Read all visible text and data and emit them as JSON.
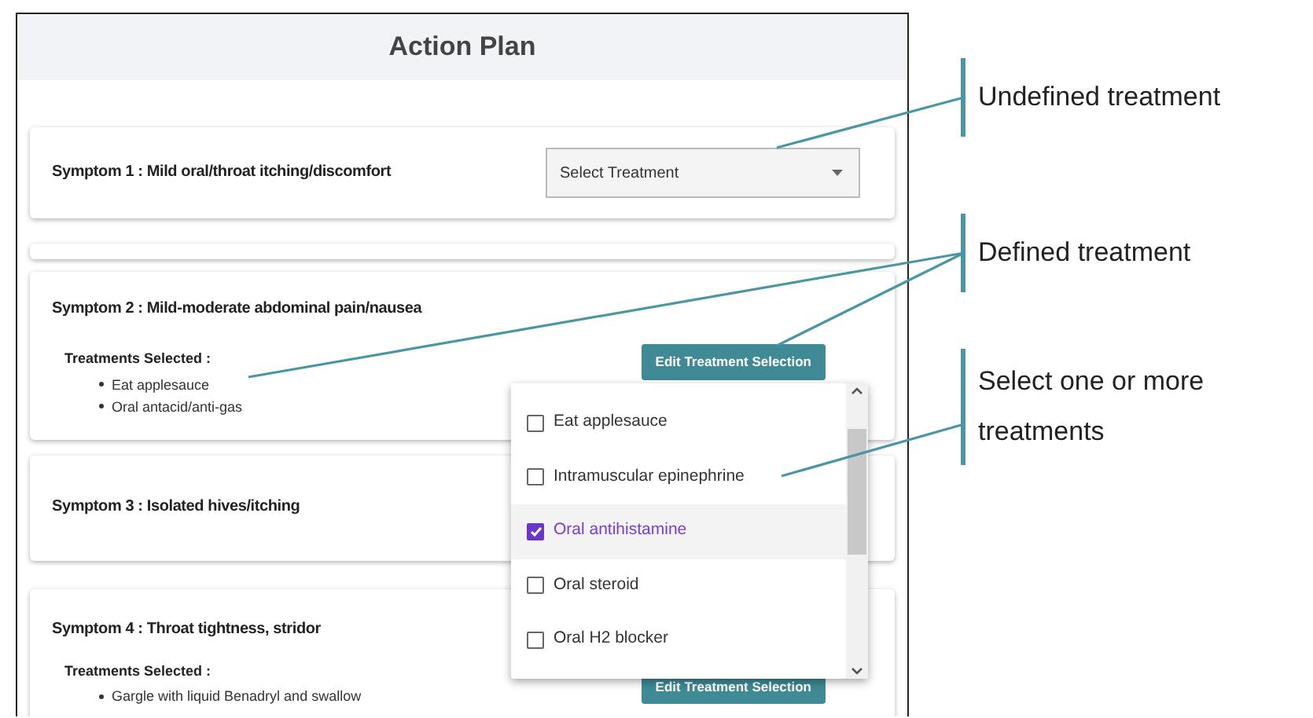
{
  "app": {
    "title": "Action Plan",
    "symptoms": [
      {
        "label": "Symptom 1 : Mild oral/throat itching/discomfort",
        "kind": "select",
        "placeholder": "Select Treatment"
      },
      {
        "label": "Symptom 2 : Mild-moderate abdominal pain/nausea",
        "kind": "selected",
        "treatments_heading": "Treatments Selected :",
        "treatments": [
          "Eat applesauce",
          "Oral antacid/anti-gas"
        ],
        "button": "Edit Treatment Selection"
      },
      {
        "label": "Symptom 3 : Isolated hives/itching",
        "kind": "plain"
      },
      {
        "label": "Symptom 4 : Throat tightness, stridor",
        "kind": "selected",
        "treatments_heading": "Treatments Selected :",
        "treatments": [
          "Gargle with liquid Benadryl and swallow"
        ],
        "button": "Edit Treatment Selection"
      }
    ],
    "menu": {
      "options": [
        {
          "label": "Eat applesauce",
          "checked": false,
          "selected": false
        },
        {
          "label": "Intramuscular epinephrine",
          "checked": false,
          "selected": false
        },
        {
          "label": "Oral antihistamine",
          "checked": true,
          "selected": true
        },
        {
          "label": "Oral steroid",
          "checked": false,
          "selected": false
        },
        {
          "label": "Oral H2 blocker",
          "checked": false,
          "selected": false
        }
      ]
    }
  },
  "annotations": [
    {
      "text": "Undefined treatment"
    },
    {
      "text": "Defined treatment"
    },
    {
      "text": "Select one or more treatments"
    }
  ]
}
